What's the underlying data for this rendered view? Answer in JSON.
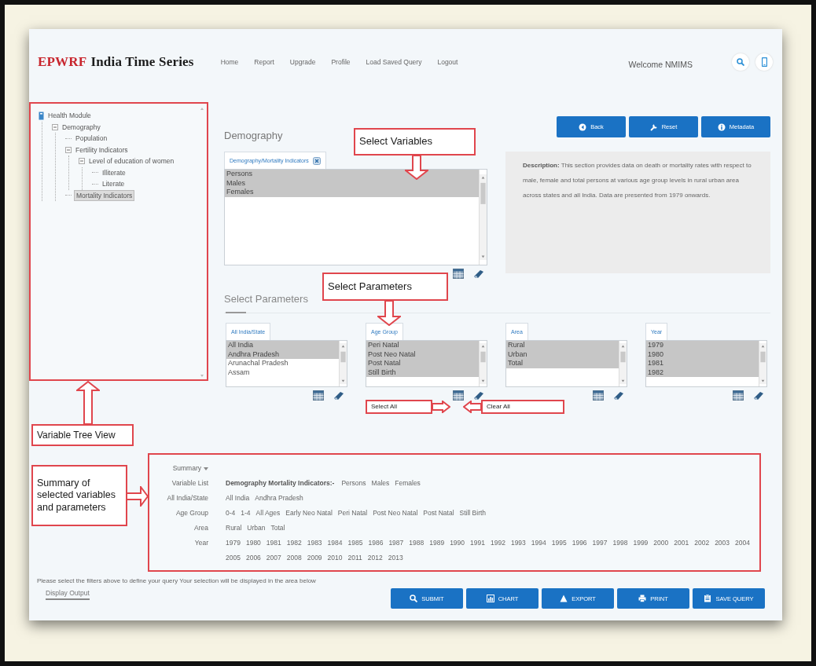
{
  "header": {
    "brand_mark": "EPWRF",
    "brand_name": "India Time Series",
    "nav": [
      "Home",
      "Report",
      "Upgrade",
      "Profile",
      "Load Saved Query",
      "Logout"
    ],
    "welcome": "Welcome NMIMS"
  },
  "tree": [
    {
      "label": "Health Module",
      "selected": false,
      "children": [
        {
          "label": "Demography",
          "selected": false,
          "children": [
            {
              "label": "Population",
              "selected": false
            },
            {
              "label": "Fertility Indicators",
              "selected": false,
              "children": [
                {
                  "label": "Level of education of women",
                  "selected": false,
                  "children": [
                    {
                      "label": "Illiterate",
                      "selected": false
                    },
                    {
                      "label": "Literate",
                      "selected": false
                    }
                  ]
                }
              ]
            },
            {
              "label": "Mortality Indicators",
              "selected": true
            }
          ]
        }
      ]
    }
  ],
  "section_title": "Demography",
  "top_buttons": [
    {
      "label": "Back"
    },
    {
      "label": "Reset"
    },
    {
      "label": "Metadata"
    }
  ],
  "variables": {
    "tag": "Demography/Mortality Indicators",
    "options": [
      {
        "label": "Persons",
        "selected": true
      },
      {
        "label": "Males",
        "selected": true
      },
      {
        "label": "Females",
        "selected": true
      }
    ]
  },
  "description": "**Description:** This section provides data on death or mortality rates with respect to male, female and total persons at various age group levels in rural urban area across states and all India. Data are presented from 1979 onwards.",
  "parameters_title": "Select Parameters",
  "parameters": [
    {
      "tag": "All India/State",
      "options": [
        {
          "label": "All India",
          "selected": true
        },
        {
          "label": "Andhra Pradesh",
          "selected": true
        },
        {
          "label": "Arunachal Pradesh",
          "selected": false
        },
        {
          "label": "Assam",
          "selected": false
        }
      ]
    },
    {
      "tag": "Age Group",
      "options": [
        {
          "label": "Peri Natal",
          "selected": true
        },
        {
          "label": "Post Neo Natal",
          "selected": true
        },
        {
          "label": "Post Natal",
          "selected": true
        },
        {
          "label": "Still Birth",
          "selected": true
        }
      ]
    },
    {
      "tag": "Area",
      "options": [
        {
          "label": "Rural",
          "selected": true
        },
        {
          "label": "Urban",
          "selected": true
        },
        {
          "label": "Total",
          "selected": true
        }
      ]
    },
    {
      "tag": "Year",
      "options": [
        {
          "label": "1979",
          "selected": true
        },
        {
          "label": "1980",
          "selected": true
        },
        {
          "label": "1981",
          "selected": true
        },
        {
          "label": "1982",
          "selected": true
        }
      ]
    }
  ],
  "summary": {
    "title": "Summary",
    "rows": [
      {
        "label": "Variable List",
        "group": "Demography Mortality Indicators:-",
        "items": [
          "Persons",
          "Males",
          "Females"
        ]
      },
      {
        "label": "All India/State",
        "items": [
          "All India",
          "Andhra Pradesh"
        ]
      },
      {
        "label": "Age Group",
        "items": [
          "0-4",
          "1-4",
          "All Ages",
          "Early Neo Natal",
          "Peri Natal",
          "Post Neo Natal",
          "Post Natal",
          "Still Birth"
        ]
      },
      {
        "label": "Area",
        "items": [
          "Rural",
          "Urban",
          "Total"
        ]
      },
      {
        "label": "Year",
        "items": [
          "1979",
          "1980",
          "1981",
          "1982",
          "1983",
          "1984",
          "1985",
          "1986",
          "1987",
          "1988",
          "1989",
          "1990",
          "1991",
          "1992",
          "1993",
          "1994",
          "1995",
          "1996",
          "1997",
          "1998",
          "1999",
          "2000",
          "2001",
          "2002",
          "2003",
          "2004",
          "2005",
          "2006",
          "2007",
          "2008",
          "2009",
          "2010",
          "2011",
          "2012",
          "2013"
        ]
      }
    ]
  },
  "hint": "Please select the filters above to define your query Your selection will be displayed in the area below",
  "output_tab": "Display Output",
  "actions": [
    {
      "label": "SUBMIT"
    },
    {
      "label": "CHART"
    },
    {
      "label": "EXPORT"
    },
    {
      "label": "PRINT"
    },
    {
      "label": "SAVE QUERY"
    }
  ],
  "callouts": [
    {
      "text": "Select Variables"
    },
    {
      "text": "Select Parameters"
    },
    {
      "text": "Select All"
    },
    {
      "text": "Clear All"
    },
    {
      "text": "Variable Tree View"
    },
    {
      "text": "Summary of selected variables and parameters"
    }
  ]
}
